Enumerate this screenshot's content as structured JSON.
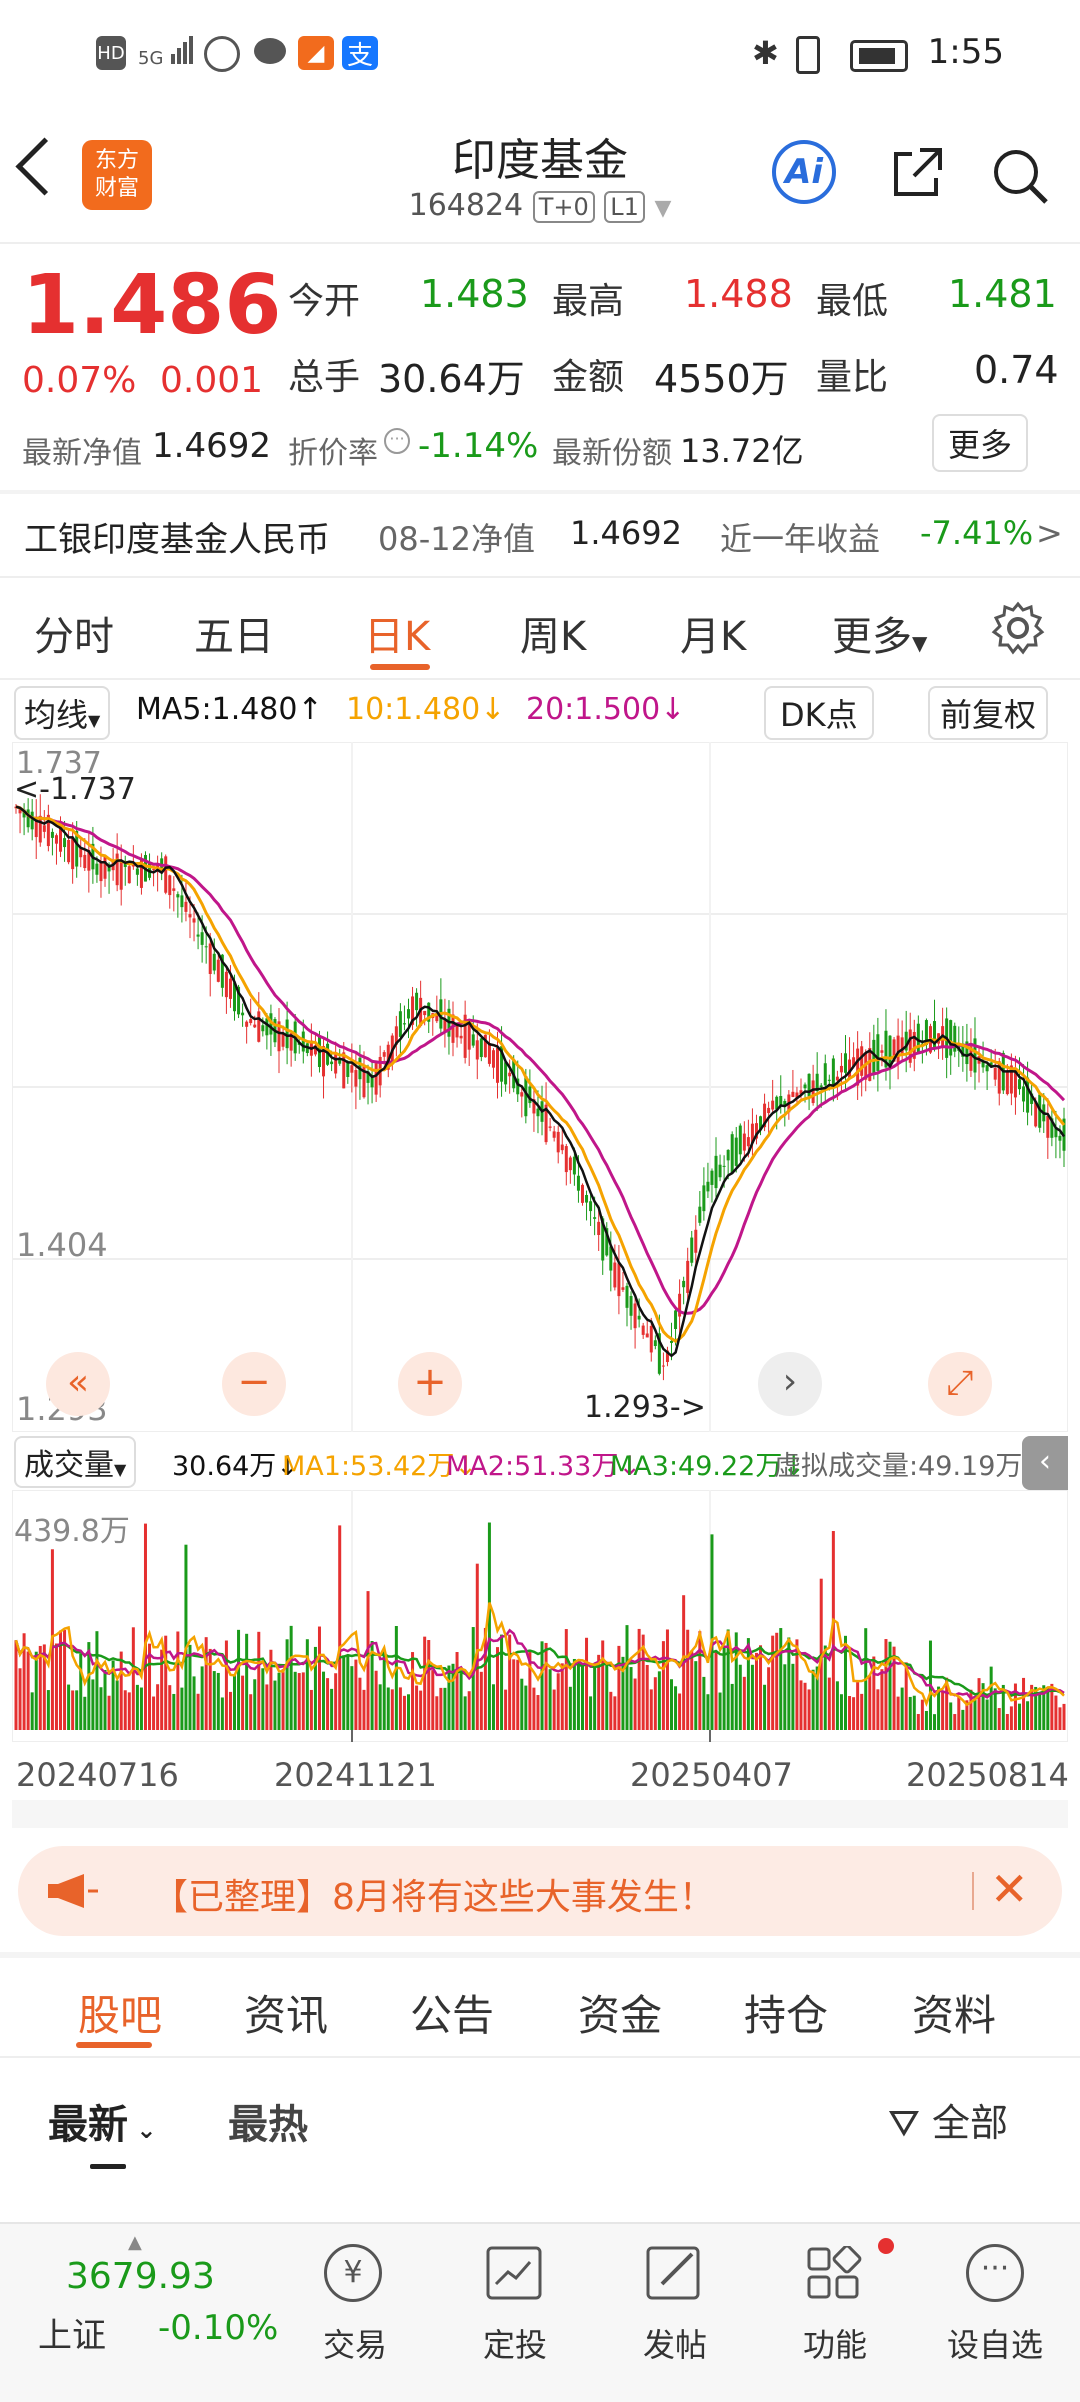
{
  "status": {
    "time": "1:55",
    "left_icons": [
      "HD",
      "5G",
      "signal-icon",
      "hotspot-icon",
      "wechat-icon",
      "app-icon",
      "alipay-icon"
    ],
    "right_icons": [
      "bluetooth-icon",
      "vibrate-icon",
      "battery-icon"
    ]
  },
  "header": {
    "logo_line1": "东方",
    "logo_line2": "财富",
    "title": "印度基金",
    "code": "164824",
    "badge1": "T+0",
    "badge2": "L1",
    "ai_label": "Ai"
  },
  "quote": {
    "price": "1.486",
    "change_pct": "0.07%",
    "change_val": "0.001",
    "open_label": "今开",
    "open": "1.483",
    "high_label": "最高",
    "high": "1.488",
    "low_label": "最低",
    "low": "1.481",
    "vol_label": "总手",
    "vol": "30.64万",
    "amount_label": "金额",
    "amount": "4550万",
    "ratio_label": "量比",
    "ratio": "0.74",
    "nav_label": "最新净值",
    "nav": "1.4692",
    "discount_label": "折价率",
    "discount": "-1.14%",
    "shares_label": "最新份额",
    "shares": "13.72亿",
    "more_btn": "更多"
  },
  "fund_info": {
    "name": "工银印度基金人民币",
    "nav_date_label": "08-12净值",
    "nav_value": "1.4692",
    "year_label": "近一年收益",
    "year_return": "-7.41%",
    "arrow": ">"
  },
  "period_tabs": [
    "分时",
    "五日",
    "日K",
    "周K",
    "月K",
    "更多"
  ],
  "period_active": 2,
  "ma_bar": {
    "selector": "均线",
    "ma5": "MA5:1.480",
    "ma10": "10:1.480",
    "ma20": "20:1.500",
    "dk_btn": "DK点",
    "fq_btn": "前复权"
  },
  "kchart": {
    "y_top": "1.737",
    "y_mid": "1.404",
    "y_bottom": "1.293",
    "max_note": "<-1.737",
    "min_note": "1.293->",
    "colors": {
      "ma5": "#111111",
      "ma10": "#f5a300",
      "ma20": "#c0168a",
      "up": "#e53030",
      "down": "#1a9a1a"
    }
  },
  "vol_bar": {
    "selector": "成交量",
    "vol": "30.64万",
    "ma1": "MA1:53.42万",
    "ma2": "MA2:51.33万",
    "ma3": "MA3:49.22万",
    "virtual": "虚拟成交量:49.19万",
    "y_max": "439.8万"
  },
  "dates": [
    "20240716",
    "20241121",
    "20250407",
    "20250814"
  ],
  "banner": {
    "text": "【已整理】8月将有这些大事发生！"
  },
  "section_tabs": [
    "股吧",
    "资讯",
    "公告",
    "资金",
    "持仓",
    "资料"
  ],
  "section_active": 0,
  "sort_tabs": {
    "latest": "最新",
    "hot": "最热",
    "filter": "全部"
  },
  "bottom_nav": {
    "index_value": "3679.93",
    "index_name": "上证",
    "index_change": "-0.10%",
    "items": [
      "交易",
      "定投",
      "发帖",
      "功能",
      "设自选"
    ]
  }
}
